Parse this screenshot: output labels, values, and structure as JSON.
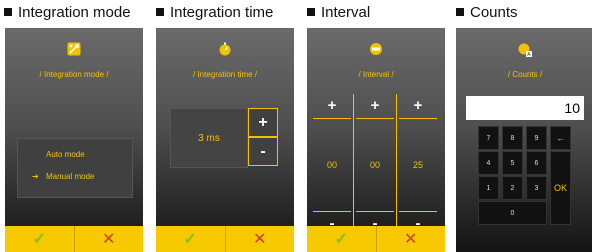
{
  "sections": [
    {
      "label": "Integration mode"
    },
    {
      "label": "Integration time"
    },
    {
      "label": "Interval"
    },
    {
      "label": "Counts"
    }
  ],
  "integration_mode": {
    "title": "/ Integration mode /",
    "options": [
      "Auto mode",
      "Manual mode"
    ],
    "selected": "Manual mode",
    "icon": "integration-mode-icon"
  },
  "integration_time": {
    "title": "/ Integration time /",
    "value": "3 ms",
    "plus": "+",
    "minus": "-",
    "icon": "stopwatch-icon"
  },
  "interval": {
    "title": "/ Interval /",
    "values": [
      "00",
      "00",
      "25"
    ],
    "plus": "+",
    "minus": "-",
    "icon": "timer-icon"
  },
  "counts": {
    "title": "/ Counts /",
    "value": "10",
    "keys": [
      "7",
      "8",
      "9",
      "←",
      "4",
      "5",
      "6",
      "1",
      "2",
      "3",
      "OK",
      "0"
    ],
    "icon": "counter-icon"
  },
  "footer": {
    "ok": "✓",
    "cancel": "✕"
  },
  "colors": {
    "accent": "#f2c200",
    "footer": "#f7c900",
    "ok": "#86c01a",
    "cancel": "#d83a3a"
  }
}
